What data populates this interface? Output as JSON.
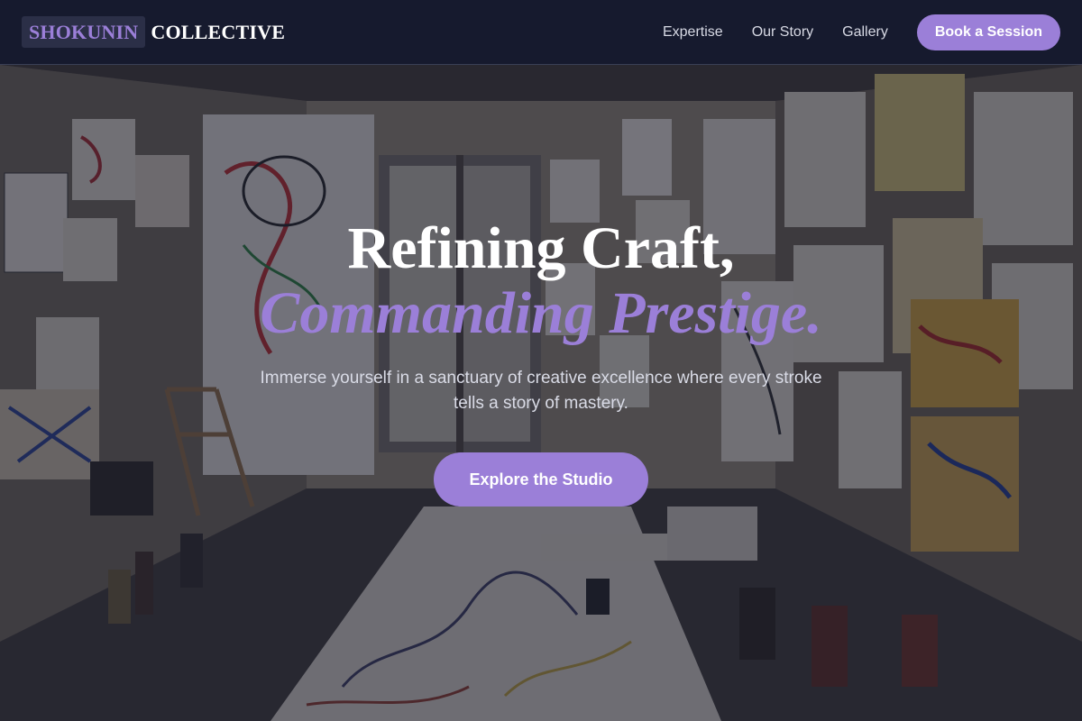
{
  "brand": {
    "highlight": "SHOKUNIN",
    "rest": "COLLECTIVE"
  },
  "nav": {
    "links": [
      "Expertise",
      "Our Story",
      "Gallery"
    ],
    "cta": "Book a Session"
  },
  "hero": {
    "headline_line1": "Refining Craft,",
    "headline_line2": "Commanding Prestige.",
    "subtitle": "Immerse yourself in a sanctuary of creative excellence where every stroke tells a story of mastery.",
    "cta": "Explore the Studio",
    "background_icon": "art-studio-photo"
  },
  "colors": {
    "accent": "#9b7fd8",
    "header_bg": "#161a2e",
    "text_light": "#ffffff"
  }
}
